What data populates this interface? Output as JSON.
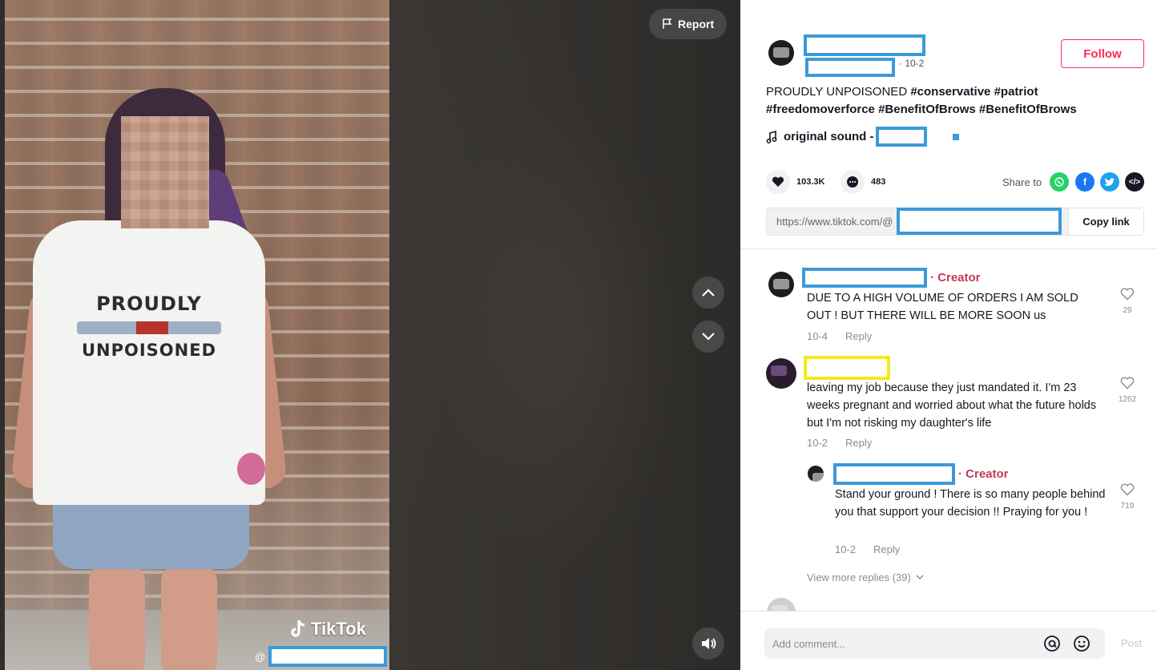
{
  "video": {
    "report_label": "Report",
    "shirt_line1": "PROUDLY",
    "shirt_line2": "UNPOISONED",
    "watermark_brand": "TikTok",
    "watermark_at": "@"
  },
  "post": {
    "date": "· 10-2",
    "follow_label": "Follow",
    "description_text": "PROUDLY UNPOISONED",
    "hashtags": [
      "#conservative",
      "#patriot",
      "#freedomoverforce",
      "#BenefitOfBrows",
      "#BenefitOfBrows"
    ],
    "sound_label": "original sound -",
    "likes": "103.3K",
    "comments": "483",
    "share_label": "Share to",
    "link_url": "https://www.tiktok.com/@",
    "copy_link_label": "Copy link"
  },
  "comments": [
    {
      "creator_tag": "· Creator",
      "text": "DUE TO A HIGH VOLUME OF ORDERS I AM SOLD OUT ! BUT THERE WILL BE MORE SOON us",
      "date": "10-4",
      "reply_label": "Reply",
      "likes": "29"
    },
    {
      "text": "leaving my job because they just mandated it. I'm 23 weeks pregnant and worried about what the future holds but I'm not risking my daughter's life",
      "date": "10-2",
      "reply_label": "Reply",
      "likes": "1262"
    },
    {
      "creator_tag": "· Creator",
      "text": "Stand your ground ! There is so many people behind you that support your decision !! Praying for you !",
      "date": "10-2",
      "reply_label": "Reply",
      "likes": "719"
    }
  ],
  "view_more_replies": "View more replies (39)",
  "comment_box": {
    "placeholder": "Add comment...",
    "post_label": "Post"
  },
  "colors": {
    "accent": "#fe2c55",
    "creator": "#c33a56",
    "redaction_blue": "#3b9ad9",
    "redaction_yellow": "#f5e91a",
    "whatsapp": "#25d366",
    "facebook": "#1877f2",
    "twitter": "#1da1f2",
    "embed": "#161823"
  },
  "icons": [
    "flag-icon",
    "chevron-up-icon",
    "chevron-down-icon",
    "volume-icon",
    "music-note-icon",
    "heart-icon",
    "comment-icon",
    "whatsapp-icon",
    "facebook-icon",
    "twitter-icon",
    "embed-icon",
    "at-icon",
    "emoji-icon",
    "tiktok-logo-icon"
  ]
}
